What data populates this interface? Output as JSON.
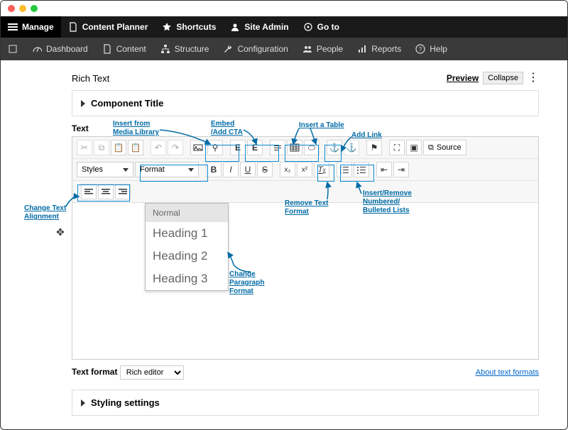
{
  "topbar": {
    "manage": "Manage",
    "content_planner": "Content Planner",
    "shortcuts": "Shortcuts",
    "site_admin": "Site Admin",
    "go_to": "Go to"
  },
  "subbar": {
    "dashboard": "Dashboard",
    "content": "Content",
    "structure": "Structure",
    "configuration": "Configuration",
    "people": "People",
    "reports": "Reports",
    "help": "Help"
  },
  "section": {
    "title": "Rich Text",
    "preview": "Preview",
    "collapse": "Collapse"
  },
  "component_title": "Component Title",
  "text_label": "Text",
  "toolbar": {
    "styles": "Styles",
    "format": "Format",
    "source": "Source"
  },
  "format_options": [
    "Normal",
    "Heading 1",
    "Heading 2",
    "Heading 3"
  ],
  "text_format_label": "Text format",
  "text_format_select": "Rich editor",
  "about_link": "About text formats",
  "styling_settings": "Styling settings",
  "annotations": {
    "media_library": "Insert from Media Library",
    "embed_cta": "Embed /Add CTA",
    "insert_table": "Insert a Table",
    "add_link": "Add Link",
    "change_align": "Change Text Alignment",
    "remove_format": "Remove Text Format",
    "lists": "Insert/Remove Numbered/ Bulleted Lists",
    "change_para": "Change Paragraph Format"
  }
}
